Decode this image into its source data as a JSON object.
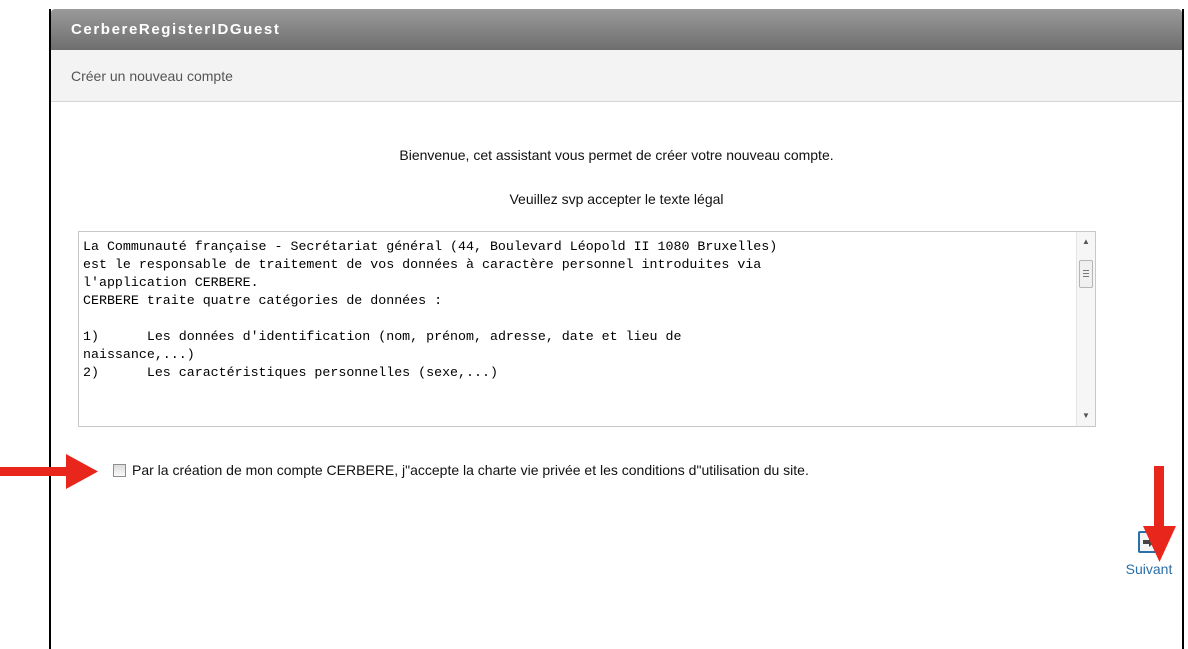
{
  "window": {
    "title": "CerbereRegisterIDGuest"
  },
  "header": {
    "subtitle": "Créer un nouveau compte"
  },
  "intro": {
    "welcome": "Bienvenue, cet assistant vous permet de créer votre nouveau compte.",
    "instruction": "Veuillez svp accepter le texte légal"
  },
  "legal": {
    "text": "La Communauté française - Secrétariat général (44, Boulevard Léopold II 1080 Bruxelles)\nest le responsable de traitement de vos données à caractère personnel introduites via\nl'application CERBERE.\nCERBERE traite quatre catégories de données :\n\n1)\tLes données d'identification (nom, prénom, adresse, date et lieu de\nnaissance,...)\n2)\tLes caractéristiques personnelles (sexe,...)"
  },
  "consent": {
    "label": "Par la création de mon compte CERBERE, j\"accepte la charte vie privée et les conditions d\"utilisation du site.",
    "checked": false
  },
  "actions": {
    "next_label": "Suivant",
    "next_icon": "arrow-right-icon"
  },
  "colors": {
    "annotation_arrow": "#e8261c",
    "accent": "#2b6fa8"
  }
}
